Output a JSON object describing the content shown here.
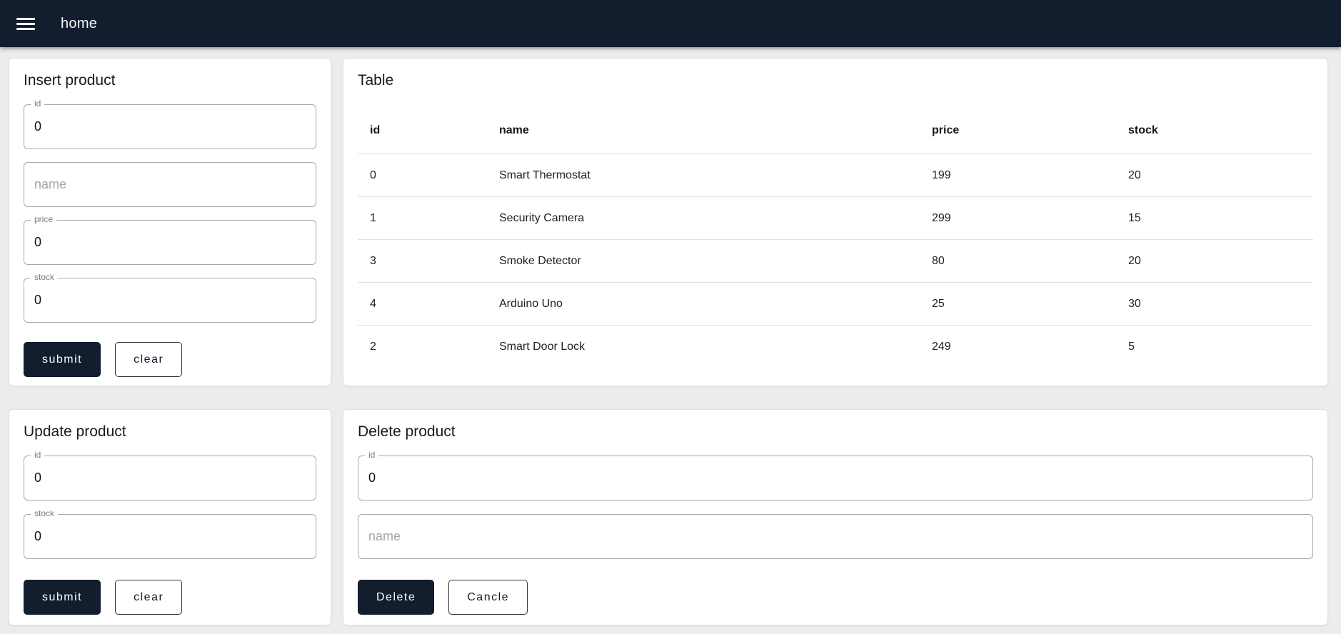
{
  "colors": {
    "primary": "#121d2d",
    "page_bg": "#ececec"
  },
  "appbar": {
    "title": "home",
    "menu_icon": "hamburger-icon"
  },
  "insert_card": {
    "title": "Insert product",
    "fields": {
      "id": {
        "label": "id",
        "value": "0"
      },
      "name": {
        "placeholder": "name"
      },
      "price": {
        "label": "price",
        "value": "0"
      },
      "stock": {
        "label": "stock",
        "value": "0"
      }
    },
    "buttons": {
      "submit": "submit",
      "clear": "clear"
    }
  },
  "table_card": {
    "title": "Table",
    "columns": [
      "id",
      "name",
      "price",
      "stock"
    ],
    "rows": [
      {
        "id": "0",
        "name": "Smart Thermostat",
        "price": "199",
        "stock": "20"
      },
      {
        "id": "1",
        "name": "Security Camera",
        "price": "299",
        "stock": "15"
      },
      {
        "id": "3",
        "name": "Smoke Detector",
        "price": "80",
        "stock": "20"
      },
      {
        "id": "4",
        "name": "Arduino Uno",
        "price": "25",
        "stock": "30"
      },
      {
        "id": "2",
        "name": "Smart Door Lock",
        "price": "249",
        "stock": "5"
      }
    ]
  },
  "update_card": {
    "title": "Update product",
    "fields": {
      "id": {
        "label": "id",
        "value": "0"
      },
      "stock": {
        "label": "stock",
        "value": "0"
      }
    },
    "buttons": {
      "submit": "submit",
      "clear": "clear"
    }
  },
  "delete_card": {
    "title": "Delete product",
    "fields": {
      "id": {
        "label": "id",
        "value": "0"
      },
      "name": {
        "placeholder": "name"
      }
    },
    "buttons": {
      "delete": "Delete",
      "cancel": "Cancle"
    }
  }
}
